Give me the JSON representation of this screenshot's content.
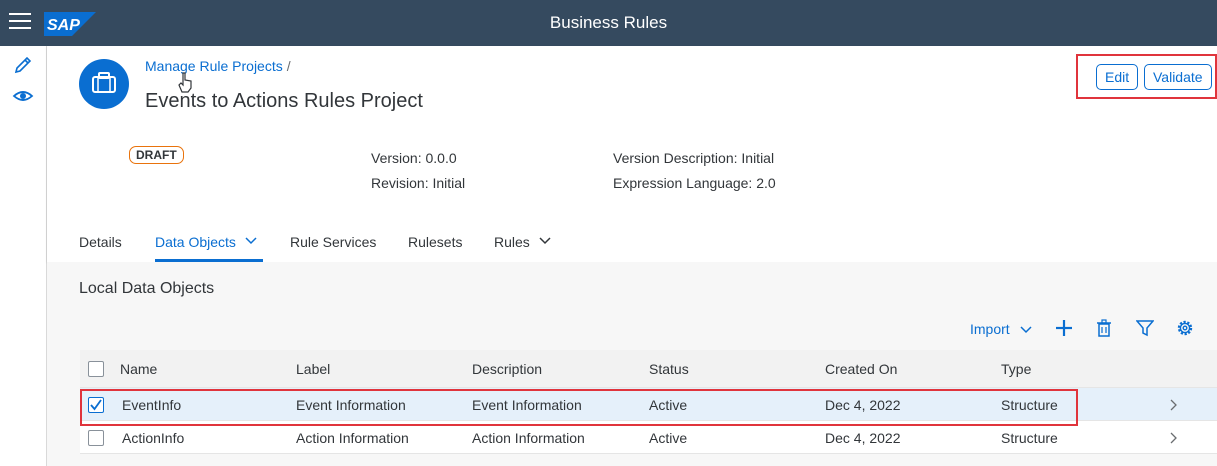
{
  "shell": {
    "title": "Business Rules",
    "logo_text": "SAP",
    "brand_color": "#354a5f"
  },
  "breadcrumb": {
    "link": "Manage Rule Projects",
    "separator": "/"
  },
  "page": {
    "title": "Events to Actions Rules Project",
    "status": "DRAFT"
  },
  "actions": {
    "edit": "Edit",
    "validate": "Validate"
  },
  "attributes": {
    "version": "Version: 0.0.0",
    "revision": "Revision: Initial",
    "version_description": "Version Description: Initial",
    "expression_language": "Expression Language: 2.0"
  },
  "tabs": [
    {
      "label": "Details"
    },
    {
      "label": "Data Objects",
      "active": true
    },
    {
      "label": "Rule Services"
    },
    {
      "label": "Rulesets"
    },
    {
      "label": "Rules"
    }
  ],
  "section": {
    "title": "Local Data Objects",
    "import_label": "Import"
  },
  "table": {
    "columns": [
      "Name",
      "Label",
      "Description",
      "Status",
      "Created On",
      "Type"
    ],
    "rows": [
      {
        "name": "EventInfo",
        "label": "Event Information",
        "description": "Event Information",
        "status": "Active",
        "created_on": "Dec 4, 2022",
        "type": "Structure",
        "selected": true
      },
      {
        "name": "ActionInfo",
        "label": "Action Information",
        "description": "Action Information",
        "status": "Active",
        "created_on": "Dec 4, 2022",
        "type": "Structure",
        "selected": false
      }
    ]
  },
  "icons": [
    "menu-icon",
    "pencil-icon",
    "eye-icon",
    "briefcase-icon",
    "chevron-down-icon",
    "add-icon",
    "delete-icon",
    "filter-icon",
    "settings-icon",
    "chevron-right-icon",
    "cursor-icon"
  ],
  "colors": {
    "accent": "#0a6ed1",
    "highlight": "#e0343c",
    "draft_border": "#e9730c"
  }
}
